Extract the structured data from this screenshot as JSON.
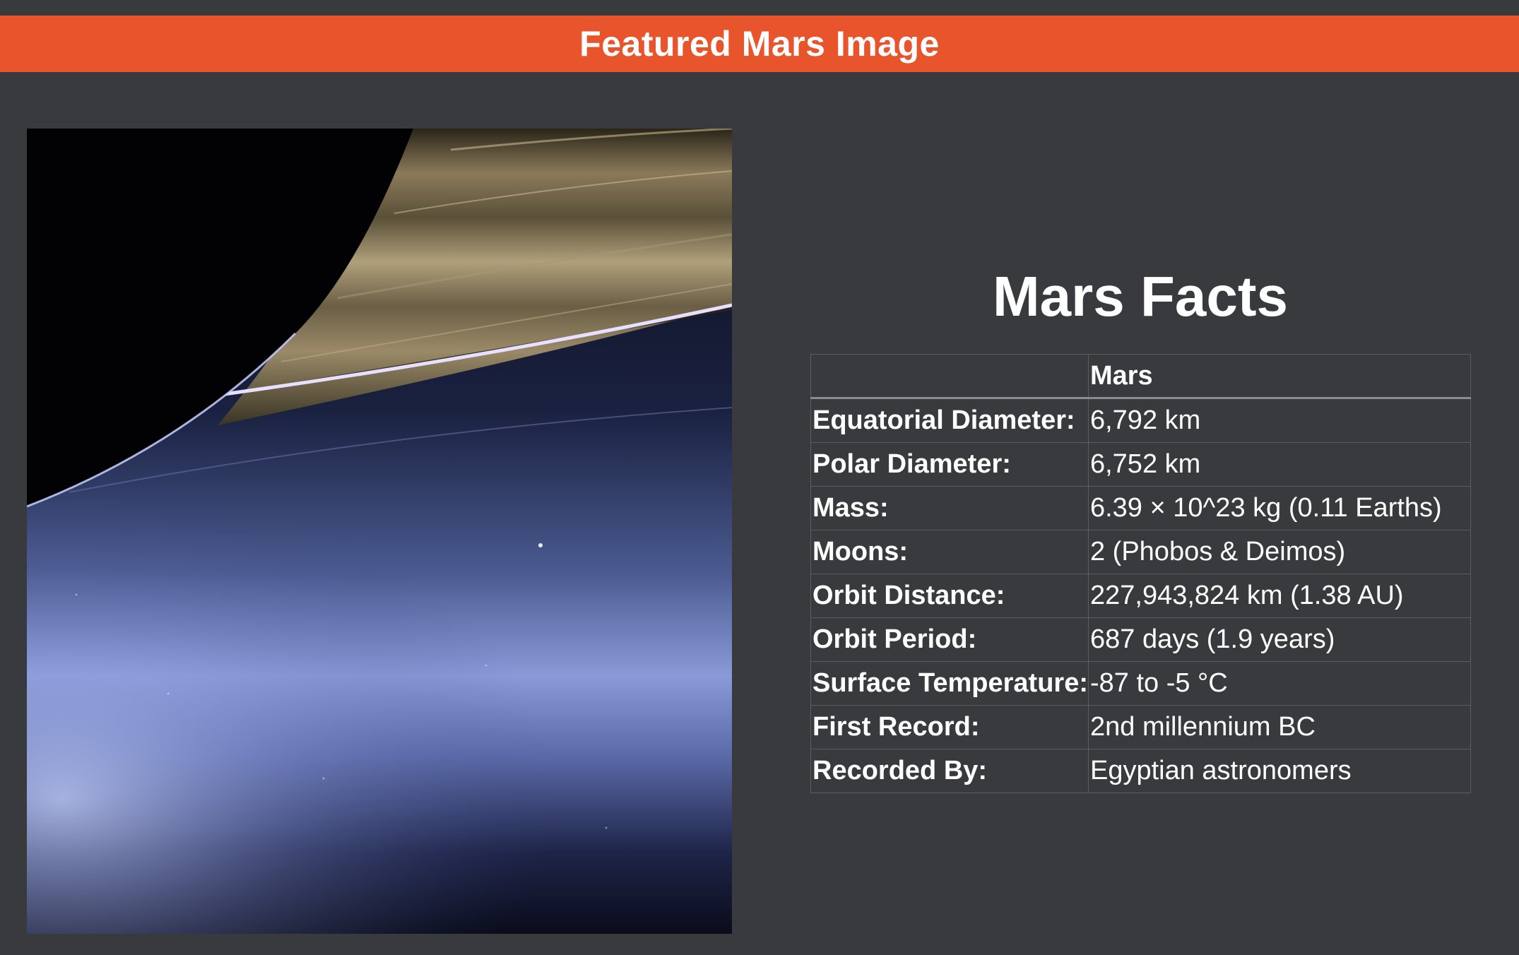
{
  "banner": {
    "title": "Featured Mars Image"
  },
  "featured_image": {
    "subject": "planet-rings-image"
  },
  "facts": {
    "title": "Mars Facts",
    "header": {
      "empty": "",
      "planet": "Mars"
    },
    "rows": [
      {
        "label": "Equatorial Diameter:",
        "value": "6,792 km"
      },
      {
        "label": "Polar Diameter:",
        "value": "6,752 km"
      },
      {
        "label": "Mass:",
        "value": "6.39 × 10^23 kg (0.11 Earths)"
      },
      {
        "label": "Moons:",
        "value": "2 (Phobos & Deimos)"
      },
      {
        "label": "Orbit Distance:",
        "value": "227,943,824 km (1.38 AU)"
      },
      {
        "label": "Orbit Period:",
        "value": "687 days (1.9 years)"
      },
      {
        "label": "Surface Temperature:",
        "value": "-87 to -5 °C"
      },
      {
        "label": "First Record:",
        "value": "2nd millennium BC"
      },
      {
        "label": "Recorded By:",
        "value": "Egyptian astronomers"
      }
    ]
  },
  "colors": {
    "page_background": "#383a3e",
    "banner_background": "#e8542b",
    "text": "#ffffff",
    "table_border": "#5a5c60"
  }
}
